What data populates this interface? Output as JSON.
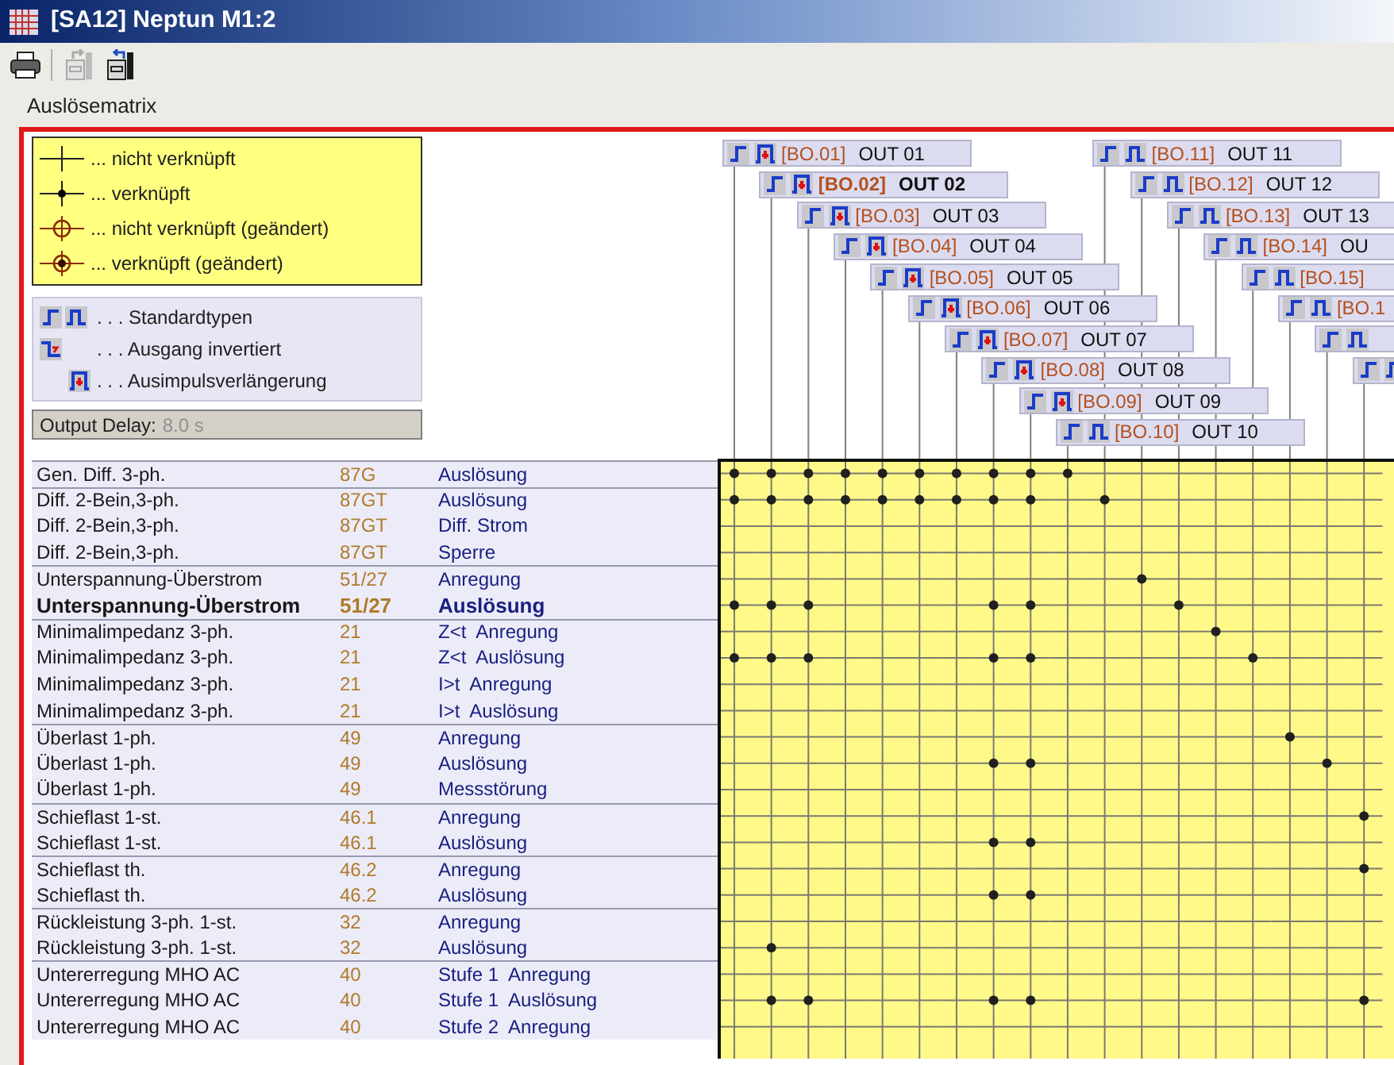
{
  "window": {
    "title": "[SA12] Neptun M1:2"
  },
  "toolbar": [
    {
      "kind": "print",
      "disabled": false
    },
    {
      "kind": "upload",
      "disabled": true
    },
    {
      "kind": "download",
      "disabled": false
    }
  ],
  "view_title": "Auslösematrix",
  "legend": [
    {
      "kind": "open",
      "label": "... nicht verknüpft"
    },
    {
      "kind": "linked",
      "label": "... verknüpft"
    },
    {
      "kind": "open_changed",
      "label": "... nicht verknüpft (geändert)"
    },
    {
      "kind": "linked_changed",
      "label": "... verknüpft (geändert)"
    }
  ],
  "type_legend": [
    {
      "kind": "standard",
      "label": ". . . Standardtypen"
    },
    {
      "kind": "inverted",
      "label": ". . . Ausgang invertiert"
    },
    {
      "kind": "extended",
      "label": ". . . Ausimpulsverlängerung"
    }
  ],
  "output_delay": {
    "label": "Output Delay:",
    "value": "8.0 s"
  },
  "output_stairs": [
    {
      "outputs": [
        {
          "code": "[BO.01]",
          "name": "OUT 01",
          "kind": "extended",
          "highlighted": false
        },
        {
          "code": "[BO.02]",
          "name": "OUT 02",
          "kind": "extended",
          "highlighted": true
        },
        {
          "code": "[BO.03]",
          "name": "OUT 03",
          "kind": "extended",
          "highlighted": false
        },
        {
          "code": "[BO.04]",
          "name": "OUT 04",
          "kind": "extended",
          "highlighted": false
        },
        {
          "code": "[BO.05]",
          "name": "OUT 05",
          "kind": "extended",
          "highlighted": false
        },
        {
          "code": "[BO.06]",
          "name": "OUT 06",
          "kind": "extended",
          "highlighted": false
        },
        {
          "code": "[BO.07]",
          "name": "OUT 07",
          "kind": "extended",
          "highlighted": false
        },
        {
          "code": "[BO.08]",
          "name": "OUT 08",
          "kind": "extended",
          "highlighted": false
        },
        {
          "code": "[BO.09]",
          "name": "OUT 09",
          "kind": "extended",
          "highlighted": false
        },
        {
          "code": "[BO.10]",
          "name": "OUT 10",
          "kind": "standard",
          "highlighted": false
        }
      ]
    },
    {
      "outputs": [
        {
          "code": "[BO.11]",
          "name": "OUT 11",
          "kind": "standard",
          "highlighted": false
        },
        {
          "code": "[BO.12]",
          "name": "OUT 12",
          "kind": "standard",
          "highlighted": false
        },
        {
          "code": "[BO.13]",
          "name": "OUT 13",
          "kind": "standard",
          "highlighted": false
        },
        {
          "code": "[BO.14]",
          "name": "OU",
          "kind": "standard",
          "highlighted": false
        },
        {
          "code": "[BO.15]",
          "kind": "standard",
          "highlighted": false
        },
        {
          "code": "[BO.1",
          "kind": "standard",
          "highlighted": false
        },
        {
          "kind": "standard"
        },
        {
          "kind": "standard"
        }
      ]
    }
  ],
  "groups": [
    {
      "rows": [
        {
          "function": "Gen. Diff. 3-ph.",
          "code": "87G",
          "signal": "Auslösung",
          "highlighted": false,
          "links": [
            true,
            true,
            true,
            true,
            true,
            true,
            true,
            true,
            true,
            true,
            false,
            false,
            false,
            false,
            false,
            false,
            false,
            false
          ]
        }
      ]
    },
    {
      "rows": [
        {
          "function": "Diff. 2-Bein,3-ph.",
          "code": "87GT",
          "signal": "Auslösung",
          "highlighted": false,
          "links": [
            true,
            true,
            true,
            true,
            true,
            true,
            true,
            true,
            true,
            false,
            true,
            false,
            false,
            false,
            false,
            false,
            false,
            false
          ]
        },
        {
          "function": "Diff. 2-Bein,3-ph.",
          "code": "87GT",
          "signal": "Diff. Strom",
          "highlighted": false,
          "links": [
            false,
            false,
            false,
            false,
            false,
            false,
            false,
            false,
            false,
            false,
            false,
            false,
            false,
            false,
            false,
            false,
            false,
            false
          ]
        },
        {
          "function": "Diff. 2-Bein,3-ph.",
          "code": "87GT",
          "signal": "Sperre",
          "highlighted": false,
          "links": [
            false,
            false,
            false,
            false,
            false,
            false,
            false,
            false,
            false,
            false,
            false,
            false,
            false,
            false,
            false,
            false,
            false,
            false
          ]
        }
      ]
    },
    {
      "rows": [
        {
          "function": "Unterspannung-Überstrom",
          "code": "51/27",
          "signal": "Anregung",
          "highlighted": false,
          "links": [
            false,
            false,
            false,
            false,
            false,
            false,
            false,
            false,
            false,
            false,
            false,
            true,
            false,
            false,
            false,
            false,
            false,
            false
          ]
        },
        {
          "function": "Unterspannung-Überstrom",
          "code": "51/27",
          "signal": "Auslösung",
          "highlighted": true,
          "links": [
            true,
            true,
            true,
            false,
            false,
            false,
            false,
            true,
            true,
            false,
            false,
            false,
            true,
            false,
            false,
            false,
            false,
            false
          ]
        }
      ]
    },
    {
      "rows": [
        {
          "function": "Minimalimpedanz 3-ph.",
          "code": "21",
          "signal": "Z<t  Anregung",
          "highlighted": false,
          "links": [
            false,
            false,
            false,
            false,
            false,
            false,
            false,
            false,
            false,
            false,
            false,
            false,
            false,
            true,
            false,
            false,
            false,
            false
          ]
        },
        {
          "function": "Minimalimpedanz 3-ph.",
          "code": "21",
          "signal": "Z<t  Auslösung",
          "highlighted": false,
          "links": [
            true,
            true,
            true,
            false,
            false,
            false,
            false,
            true,
            true,
            false,
            false,
            false,
            false,
            false,
            true,
            false,
            false,
            false
          ]
        },
        {
          "function": "Minimalimpedanz 3-ph.",
          "code": "21",
          "signal": "I>t  Anregung",
          "highlighted": false,
          "links": [
            false,
            false,
            false,
            false,
            false,
            false,
            false,
            false,
            false,
            false,
            false,
            false,
            false,
            false,
            false,
            false,
            false,
            false
          ]
        },
        {
          "function": "Minimalimpedanz 3-ph.",
          "code": "21",
          "signal": "I>t  Auslösung",
          "highlighted": false,
          "links": [
            false,
            false,
            false,
            false,
            false,
            false,
            false,
            false,
            false,
            false,
            false,
            false,
            false,
            false,
            false,
            false,
            false,
            false
          ]
        }
      ]
    },
    {
      "rows": [
        {
          "function": "Überlast 1-ph.",
          "code": "49",
          "signal": "Anregung",
          "highlighted": false,
          "links": [
            false,
            false,
            false,
            false,
            false,
            false,
            false,
            false,
            false,
            false,
            false,
            false,
            false,
            false,
            false,
            true,
            false,
            false
          ]
        },
        {
          "function": "Überlast 1-ph.",
          "code": "49",
          "signal": "Auslösung",
          "highlighted": false,
          "links": [
            false,
            false,
            false,
            false,
            false,
            false,
            false,
            true,
            true,
            false,
            false,
            false,
            false,
            false,
            false,
            false,
            true,
            false
          ]
        },
        {
          "function": "Überlast 1-ph.",
          "code": "49",
          "signal": "Messstörung",
          "highlighted": false,
          "links": [
            false,
            false,
            false,
            false,
            false,
            false,
            false,
            false,
            false,
            false,
            false,
            false,
            false,
            false,
            false,
            false,
            false,
            false
          ]
        }
      ]
    },
    {
      "rows": [
        {
          "function": "Schieflast 1-st.",
          "code": "46.1",
          "signal": "Anregung",
          "highlighted": false,
          "links": [
            false,
            false,
            false,
            false,
            false,
            false,
            false,
            false,
            false,
            false,
            false,
            false,
            false,
            false,
            false,
            false,
            false,
            true
          ]
        },
        {
          "function": "Schieflast 1-st.",
          "code": "46.1",
          "signal": "Auslösung",
          "highlighted": false,
          "links": [
            false,
            false,
            false,
            false,
            false,
            false,
            false,
            true,
            true,
            false,
            false,
            false,
            false,
            false,
            false,
            false,
            false,
            false
          ]
        }
      ]
    },
    {
      "rows": [
        {
          "function": "Schieflast th.",
          "code": "46.2",
          "signal": "Anregung",
          "highlighted": false,
          "links": [
            false,
            false,
            false,
            false,
            false,
            false,
            false,
            false,
            false,
            false,
            false,
            false,
            false,
            false,
            false,
            false,
            false,
            true
          ]
        },
        {
          "function": "Schieflast th.",
          "code": "46.2",
          "signal": "Auslösung",
          "highlighted": false,
          "links": [
            false,
            false,
            false,
            false,
            false,
            false,
            false,
            true,
            true,
            false,
            false,
            false,
            false,
            false,
            false,
            false,
            false,
            false
          ]
        }
      ]
    },
    {
      "rows": [
        {
          "function": "Rückleistung 3-ph. 1-st.",
          "code": "32",
          "signal": "Anregung",
          "highlighted": false,
          "links": [
            false,
            false,
            false,
            false,
            false,
            false,
            false,
            false,
            false,
            false,
            false,
            false,
            false,
            false,
            false,
            false,
            false,
            false
          ]
        },
        {
          "function": "Rückleistung 3-ph. 1-st.",
          "code": "32",
          "signal": "Auslösung",
          "highlighted": false,
          "links": [
            false,
            true,
            false,
            false,
            false,
            false,
            false,
            false,
            false,
            false,
            false,
            false,
            false,
            false,
            false,
            false,
            false,
            false
          ]
        }
      ]
    },
    {
      "rows": [
        {
          "function": "Untererregung MHO AC",
          "code": "40",
          "signal": "Stufe 1  Anregung",
          "highlighted": false,
          "links": [
            false,
            false,
            false,
            false,
            false,
            false,
            false,
            false,
            false,
            false,
            false,
            false,
            false,
            false,
            false,
            false,
            false,
            false
          ]
        },
        {
          "function": "Untererregung MHO AC",
          "code": "40",
          "signal": "Stufe 1  Auslösung",
          "highlighted": false,
          "links": [
            false,
            true,
            true,
            false,
            false,
            false,
            false,
            true,
            true,
            false,
            false,
            false,
            false,
            false,
            false,
            false,
            false,
            true
          ]
        },
        {
          "function": "Untererregung MHO AC",
          "code": "40",
          "signal": "Stufe 2  Anregung",
          "highlighted": false,
          "links": [
            false,
            false,
            false,
            false,
            false,
            false,
            false,
            false,
            false,
            false,
            false,
            false,
            false,
            false,
            false,
            false,
            false,
            false
          ]
        }
      ]
    }
  ]
}
